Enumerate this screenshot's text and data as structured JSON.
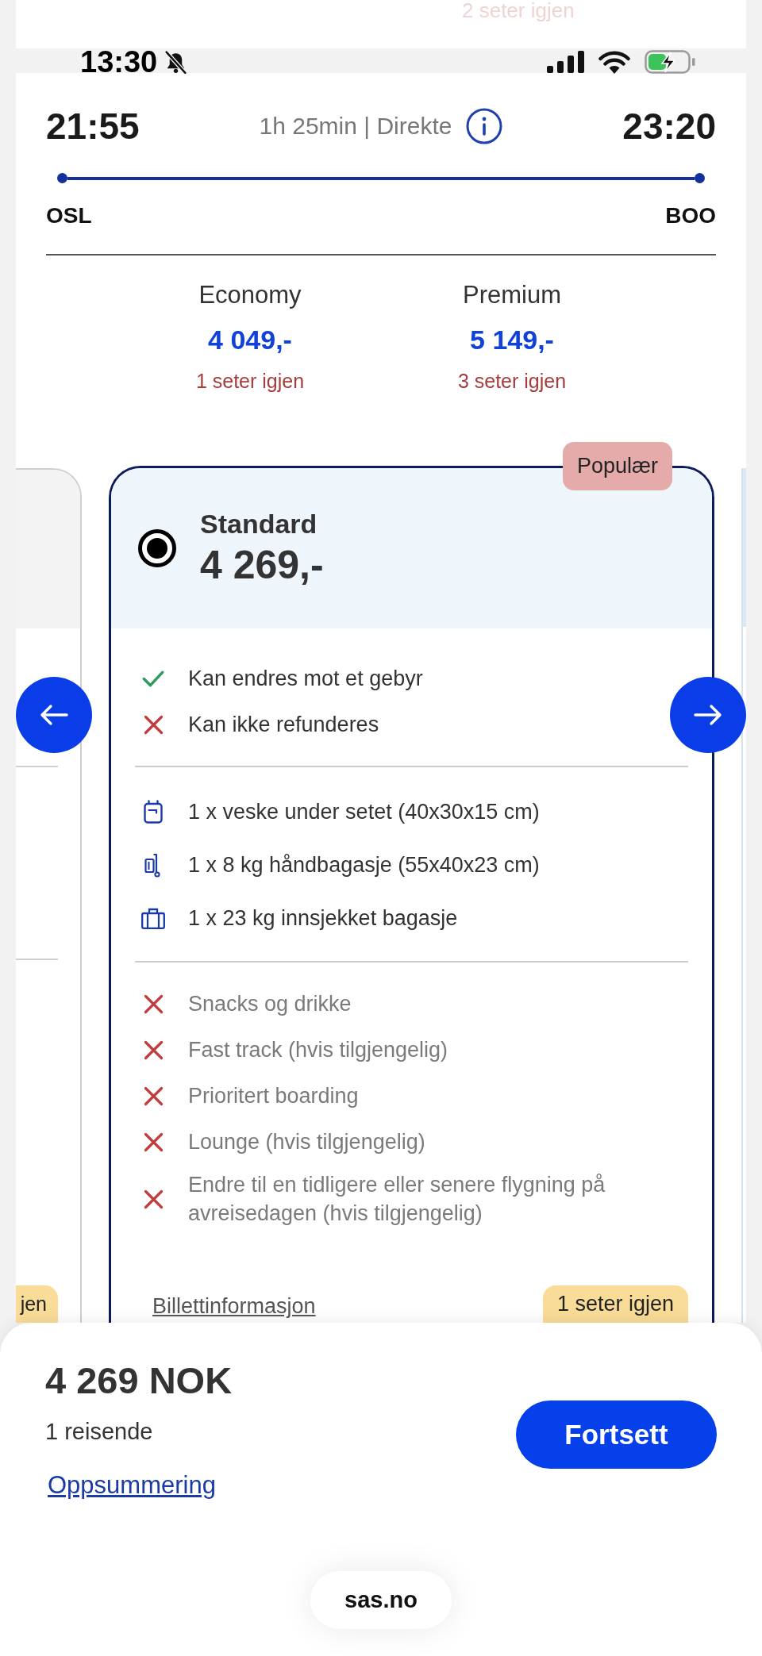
{
  "top_peek": {
    "text": "2 seter igjen"
  },
  "status_bar": {
    "time": "13:30"
  },
  "flight": {
    "departure_time": "21:55",
    "duration": "1h 25min | Direkte",
    "arrival_time": "23:20",
    "origin": "OSL",
    "destination": "BOO"
  },
  "cabin_classes": [
    {
      "name": "Economy",
      "price": "4 049,-",
      "availability": "1 seter igjen"
    },
    {
      "name": "Premium",
      "price": "5 149,-",
      "availability": "3 seter igjen"
    }
  ],
  "previous_fare_card": {
    "availability": "jen"
  },
  "fare_card": {
    "badge": "Populær",
    "name": "Standard",
    "price": "4 269,-",
    "selected": true,
    "conditions": [
      {
        "text": "Kan endres mot et gebyr",
        "included": true
      },
      {
        "text": "Kan ikke refunderes",
        "included": false
      }
    ],
    "baggage": [
      {
        "kind": "under_seat_bag",
        "text": "1 x veske under setet (40x30x15 cm)"
      },
      {
        "kind": "cabin_trolley",
        "text": "1 x 8 kg håndbagasje (55x40x23 cm)"
      },
      {
        "kind": "checked_suitcase",
        "text": "1 x 23 kg innsjekket bagasje"
      }
    ],
    "extras": [
      {
        "text": "Snacks og drikke",
        "included": false
      },
      {
        "text": "Fast track (hvis tilgjengelig)",
        "included": false
      },
      {
        "text": "Prioritert boarding",
        "included": false
      },
      {
        "text": "Lounge (hvis tilgjengelig)",
        "included": false
      },
      {
        "text": "Endre til en tidligere eller senere flygning på avreisedagen (hvis tilgjengelig)",
        "included": false
      }
    ],
    "info_link": "Billettinformasjon",
    "availability": "1 seter igjen"
  },
  "summary": {
    "total": "4 269 NOK",
    "travellers": "1 reisende",
    "link": "Oppsummering",
    "button": "Fortsett"
  },
  "browser": {
    "address": "sas.no"
  }
}
